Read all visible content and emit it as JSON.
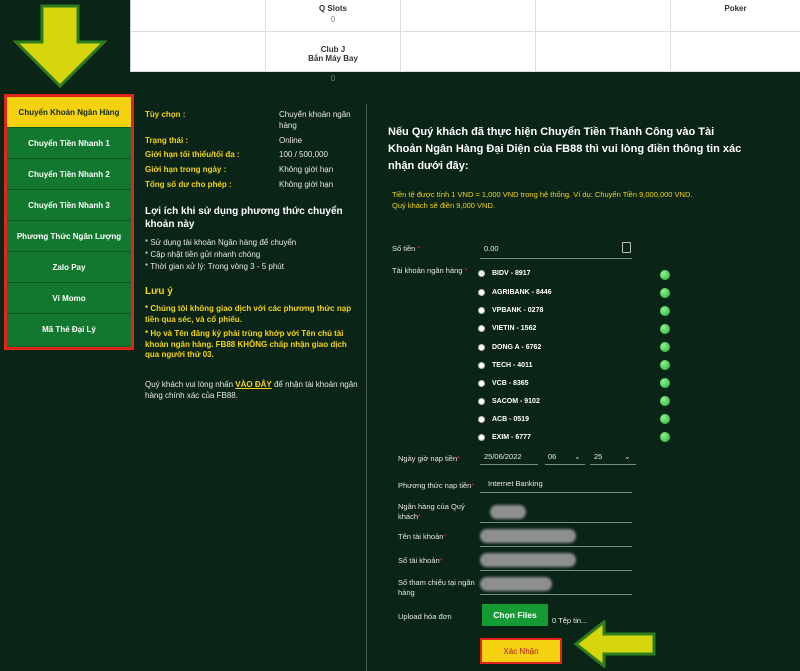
{
  "top_table": {
    "cells": [
      {
        "name": "Q Slots",
        "num": "0"
      },
      {
        "name": "Poker",
        "num": ""
      },
      {
        "name": "Club J\nBắn Máy Bay",
        "num": "0"
      }
    ]
  },
  "menu": {
    "items": [
      "Chuyển Khoản Ngân Hàng",
      "Chuyển Tiền Nhanh 1",
      "Chuyển Tiền Nhanh 2",
      "Chuyển Tiền Nhanh 3",
      "Phương Thức Ngân Lượng",
      "Zalo Pay",
      "Ví Momo",
      "Mã Thẻ Đại Lý"
    ]
  },
  "info": {
    "rows": [
      {
        "label": "Tùy chọn :",
        "value": "Chuyển khoản ngân hàng"
      },
      {
        "label": "Trạng thái :",
        "value": "Online"
      },
      {
        "label": "Giới hạn tối thiểu/tối đa :",
        "value": "100 / 500,000"
      },
      {
        "label": "Giới hạn trong ngày :",
        "value": "Không giới hạn"
      },
      {
        "label": "Tổng số dư cho phép :",
        "value": "Không giới hạn"
      }
    ],
    "benefits_title": "Lợi ích khi sử dụng phương thức chuyển khoản này",
    "benefits": [
      "* Sử dụng tài khoản Ngân hàng để chuyển",
      "* Cập nhật tiền gửi nhanh chóng",
      "* Thời gian xử lý: Trong vòng 3 - 5 phút"
    ],
    "notes_title": "Lưu ý",
    "notes": [
      "* Chúng tôi không giao dịch với các phương thức nạp tiền qua séc, và cổ phiếu.",
      "* Họ và Tên đăng ký phải trùng khớp với Tên chủ tài khoản ngân hàng. FB88 KHÔNG chấp nhận giao dịch qua người thứ 03."
    ],
    "contact_prefix": "Quý khách vui lòng nhấn",
    "contact_link": "VÀO ĐÂY",
    "contact_suffix": "để nhận tài khoản ngân hàng chính xác của FB88."
  },
  "form": {
    "heading": "Nếu Quý khách đã thực hiện Chuyển Tiền Thành Công vào Tài Khoản Ngân Hàng Đại Diện của FB88 thì vui lòng điền thông tin xác nhận dưới đây:",
    "rate_note": "Tiền tệ được tính 1 VND = 1,000 VND trong hệ thống. Ví dụ: Chuyển Tiền 9,000,000 VND. Quý khách sẽ điền 9,000 VND.",
    "amount_label": "Số tiền",
    "amount_value": "0.00",
    "bank_account_label": "Tài khoản ngân hàng",
    "banks": [
      "BIDV - 8917",
      "AGRIBANK - 8446",
      "VPBANK - 0278",
      "VIETIN - 1562",
      "DONG A - 6762",
      "TECH - 4011",
      "VCB - 8365",
      "SACOM - 9102",
      "ACB - 0519",
      "EXIM - 6777"
    ],
    "datetime_label": "Ngày giờ nạp tiền",
    "date_value": "25/06/2022",
    "hour_value": "06",
    "minute_value": "25",
    "method_label": "Phương thức nạp tiền",
    "method_value": "Internet Banking",
    "customer_bank_label": "Ngân hàng của Quý khách",
    "account_name_label": "Tên tài khoản",
    "account_number_label": "Số tài khoản",
    "reference_label": "Số tham chiếu tại ngân hàng",
    "upload_label": "Upload hóa đơn",
    "choose_files": "Chọn Files",
    "file_status": "0 Tệp tin...",
    "submit": "Xác Nhận",
    "required_mark": "*"
  },
  "colors": {
    "accent_yellow": "#f4d20f",
    "menu_green": "#12782f",
    "highlight_red": "#e3241b",
    "background": "#0b2418"
  }
}
